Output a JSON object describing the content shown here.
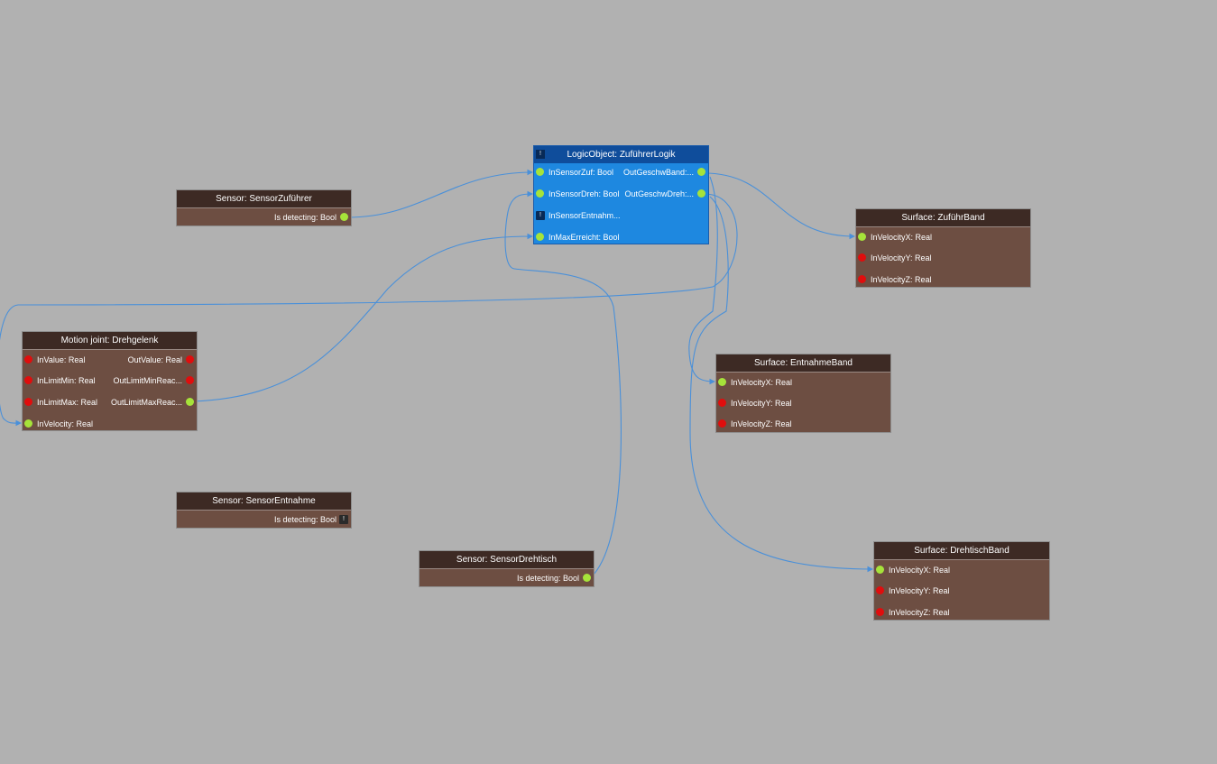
{
  "colors": {
    "canvas": "#b1b1b1",
    "node_body": "#6d4e42",
    "node_header": "#3d2a24",
    "logic_body": "#1e88e0",
    "logic_header": "#0f4d9b",
    "port_connected": "#a6e33a",
    "port_error": "#e00d0d",
    "wire": "#4a90d9"
  },
  "nodes": {
    "logic": {
      "title": "LogicObject: ZuführerLogik",
      "in1": "InSensorZuf: Bool",
      "in2": "InSensorDreh: Bool",
      "in3": "InSensorEntnahm...",
      "in4": "InMaxErreicht: Bool",
      "out1": "OutGeschwBand:...",
      "out2": "OutGeschwDreh:..."
    },
    "sensor_zufuhrer": {
      "title": "Sensor: SensorZuführer",
      "out1": "Is detecting: Bool"
    },
    "sensor_entnahme": {
      "title": "Sensor: SensorEntnahme",
      "out1": "Is detecting: Bool"
    },
    "sensor_drehtisch": {
      "title": "Sensor: SensorDrehtisch",
      "out1": "Is detecting: Bool"
    },
    "motion_joint": {
      "title": "Motion joint: Drehgelenk",
      "in1": "InValue: Real",
      "in2": "InLimitMin: Real",
      "in3": "InLimitMax: Real",
      "in4": "InVelocity: Real",
      "out1": "OutValue: Real",
      "out2": "OutLimitMinReac...",
      "out3": "OutLimitMaxReac..."
    },
    "surface_zufuhrband": {
      "title": "Surface: ZuführBand",
      "in1": "InVelocityX: Real",
      "in2": "InVelocityY: Real",
      "in3": "InVelocityZ: Real"
    },
    "surface_entnahmeband": {
      "title": "Surface: EntnahmeBand",
      "in1": "InVelocityX: Real",
      "in2": "InVelocityY: Real",
      "in3": "InVelocityZ: Real"
    },
    "surface_drehtischband": {
      "title": "Surface: DrehtischBand",
      "in1": "InVelocityX: Real",
      "in2": "InVelocityY: Real",
      "in3": "InVelocityZ: Real"
    }
  },
  "icons": {
    "warning": "warning-icon",
    "port": "port-dot-icon"
  }
}
